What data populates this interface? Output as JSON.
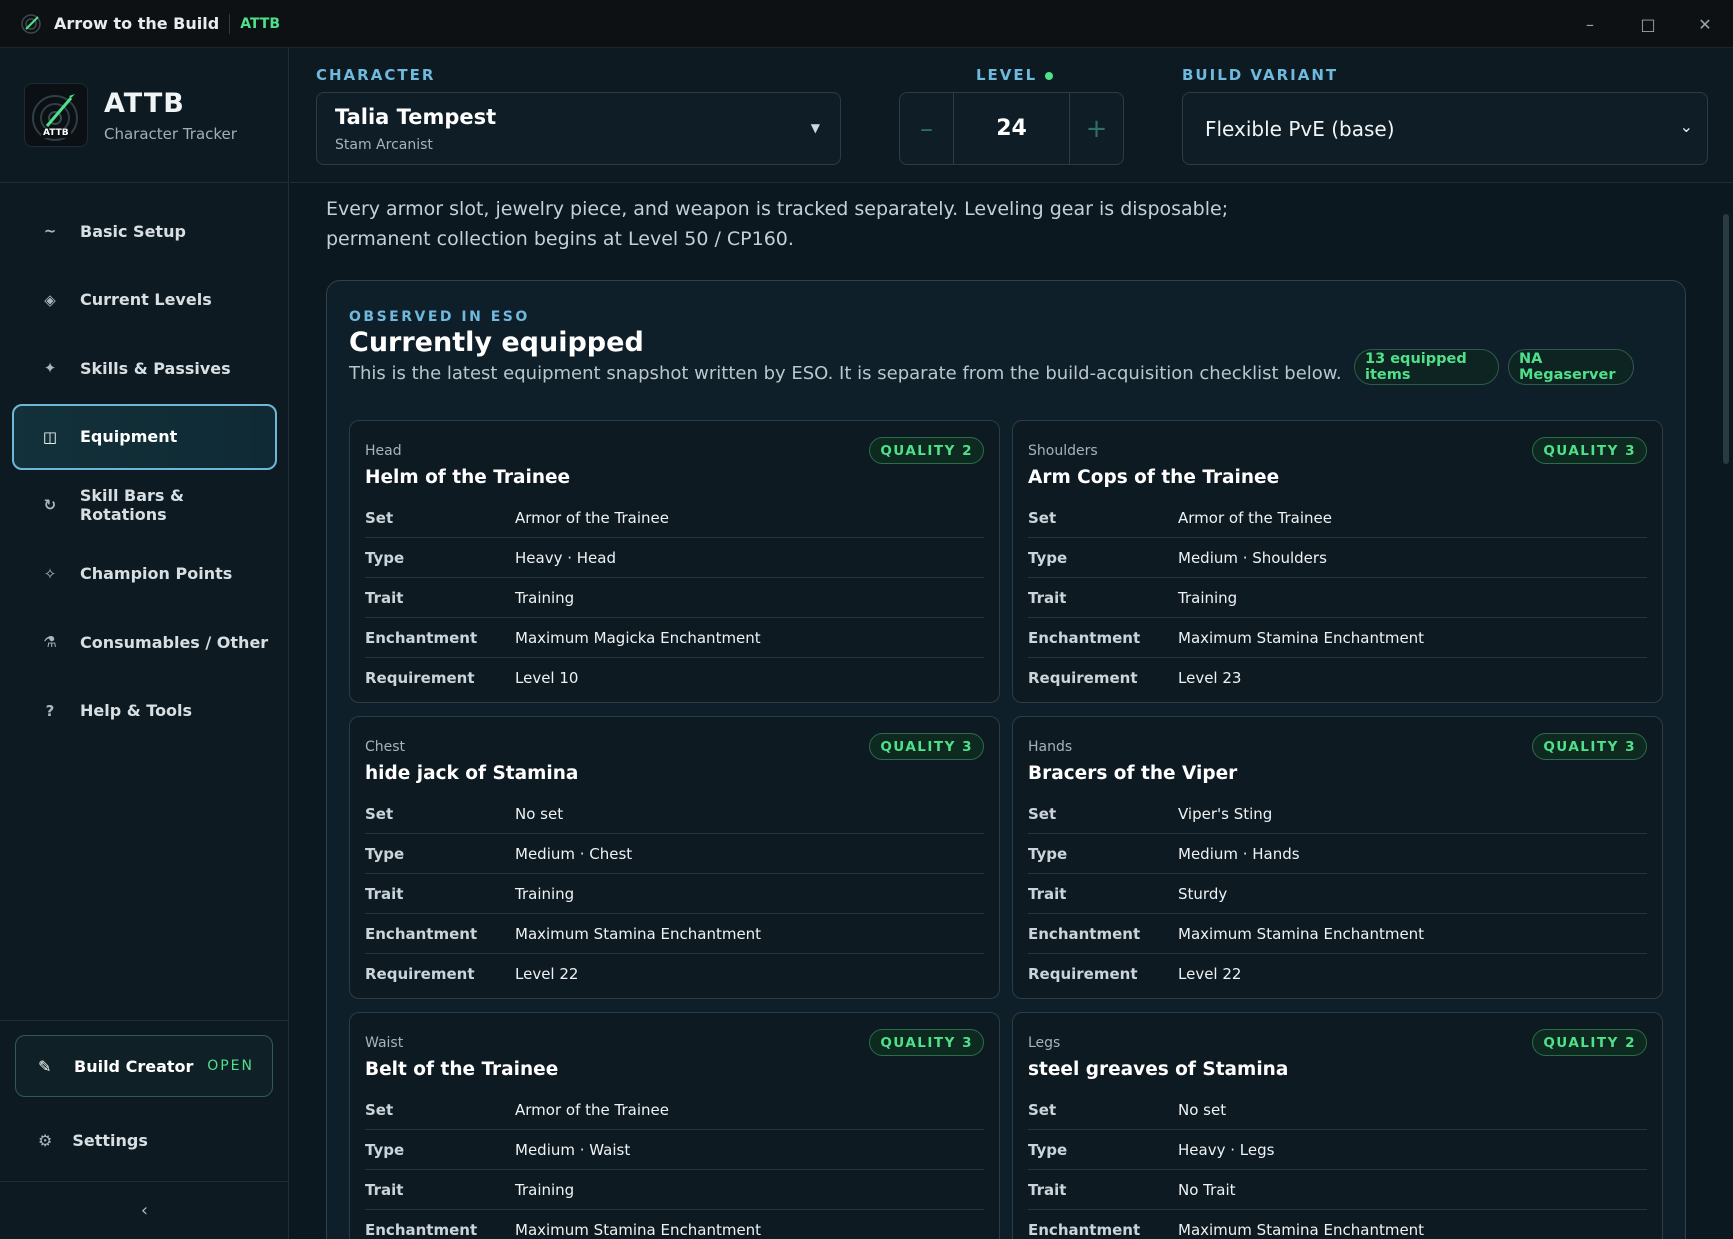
{
  "window": {
    "title": "Arrow to the Build",
    "badge": "ATTB",
    "minimize": "–",
    "maximize": "□",
    "close": "✕"
  },
  "sidebar": {
    "brand_name": "ATTB",
    "brand_sub": "Character Tracker",
    "logo_text": "ATTB",
    "items": [
      {
        "label": "Basic Setup",
        "icon": "~"
      },
      {
        "label": "Current Levels",
        "icon": "◈"
      },
      {
        "label": "Skills & Passives",
        "icon": "✦"
      },
      {
        "label": "Equipment",
        "icon": "◫"
      },
      {
        "label": "Skill Bars & Rotations",
        "icon": "↻"
      },
      {
        "label": "Champion Points",
        "icon": "✧"
      },
      {
        "label": "Consumables / Other",
        "icon": "⚗"
      },
      {
        "label": "Help & Tools",
        "icon": "?"
      }
    ],
    "build_creator": {
      "label": "Build Creator",
      "status": "OPEN",
      "icon": "✎"
    },
    "settings": {
      "label": "Settings",
      "icon": "⚙"
    },
    "collapse": "‹"
  },
  "header": {
    "character_label": "CHARACTER",
    "character_name": "Talia Tempest",
    "character_class": "Stam Arcanist",
    "level_label": "LEVEL",
    "level_value": "24",
    "level_minus": "–",
    "level_plus": "+",
    "variant_label": "BUILD VARIANT",
    "variant_value": "Flexible PvE (base)"
  },
  "main": {
    "intro": "Every armor slot, jewelry piece, and weapon is tracked separately. Leveling gear is disposable; permanent collection begins at Level 50 / CP160.",
    "panel": {
      "eyebrow": "OBSERVED IN ESO",
      "title": "Currently equipped",
      "description": "This is the latest equipment snapshot written by ESO. It is separate from the build-acquisition checklist below.",
      "count_pill": "13 equipped items",
      "server_pill": "NA Megaserver"
    },
    "row_labels": {
      "set": "Set",
      "type": "Type",
      "trait": "Trait",
      "enchantment": "Enchantment",
      "requirement": "Requirement"
    },
    "cards": [
      {
        "slot": "Head",
        "name": "Helm of the Trainee",
        "quality": "QUALITY 2",
        "set": "Armor of the Trainee",
        "type": "Heavy · Head",
        "trait": "Training",
        "enchantment": "Maximum Magicka Enchantment",
        "requirement": "Level 10"
      },
      {
        "slot": "Shoulders",
        "name": "Arm Cops of the Trainee",
        "quality": "QUALITY 3",
        "set": "Armor of the Trainee",
        "type": "Medium · Shoulders",
        "trait": "Training",
        "enchantment": "Maximum Stamina Enchantment",
        "requirement": "Level 23"
      },
      {
        "slot": "Chest",
        "name": "hide jack of Stamina",
        "quality": "QUALITY 3",
        "set": "No set",
        "type": "Medium · Chest",
        "trait": "Training",
        "enchantment": "Maximum Stamina Enchantment",
        "requirement": "Level 22"
      },
      {
        "slot": "Hands",
        "name": "Bracers of the Viper",
        "quality": "QUALITY 3",
        "set": "Viper's Sting",
        "type": "Medium · Hands",
        "trait": "Sturdy",
        "enchantment": "Maximum Stamina Enchantment",
        "requirement": "Level 22"
      },
      {
        "slot": "Waist",
        "name": "Belt of the Trainee",
        "quality": "QUALITY 3",
        "set": "Armor of the Trainee",
        "type": "Medium · Waist",
        "trait": "Training",
        "enchantment": "Maximum Stamina Enchantment",
        "requirement": ""
      },
      {
        "slot": "Legs",
        "name": "steel greaves of Stamina",
        "quality": "QUALITY 2",
        "set": "No set",
        "type": "Heavy · Legs",
        "trait": "No Trait",
        "enchantment": "Maximum Stamina Enchantment",
        "requirement": ""
      }
    ]
  },
  "colors": {
    "accent": "#4fe08a",
    "label_blue": "#6fb9de",
    "active_border": "#6fb7d8"
  }
}
